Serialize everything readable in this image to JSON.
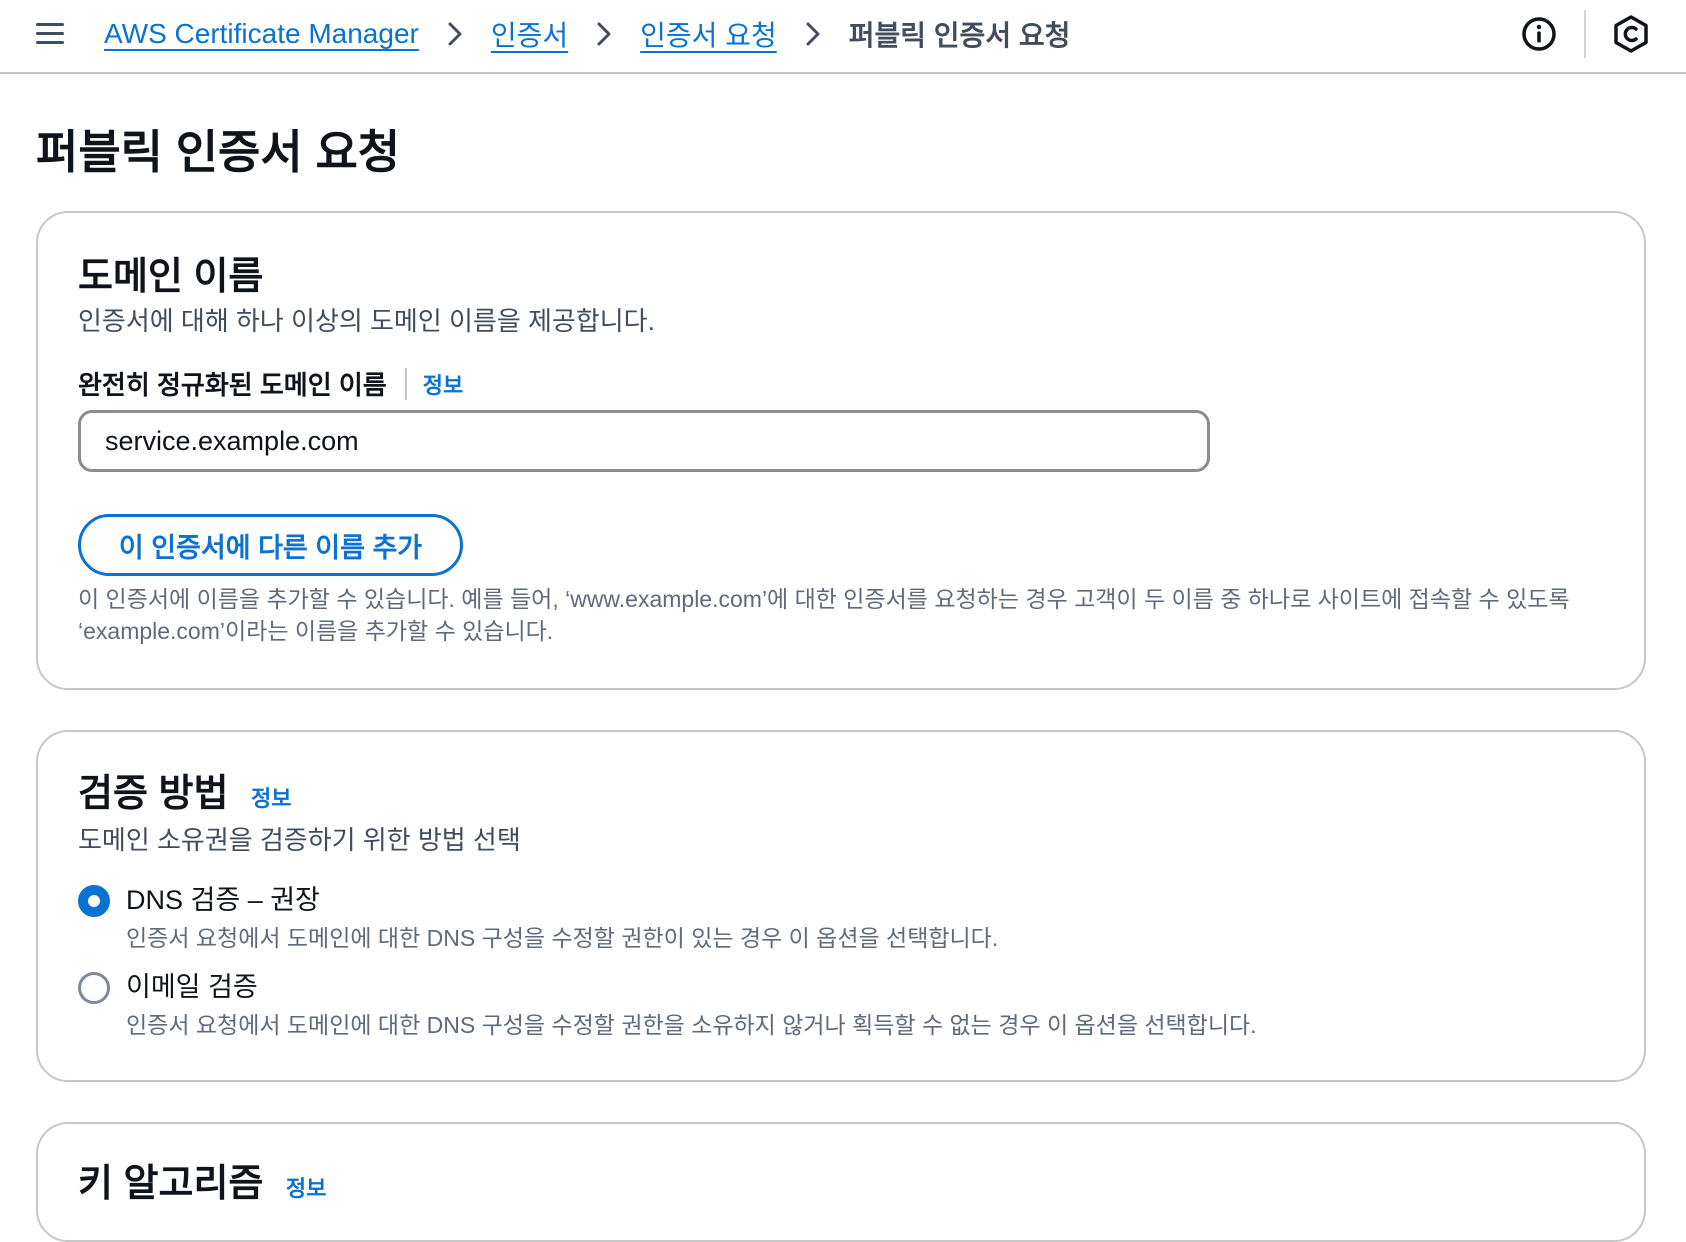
{
  "breadcrumb": {
    "items": [
      "AWS Certificate Manager",
      "인증서",
      "인증서 요청"
    ],
    "current": "퍼블릭 인증서 요청"
  },
  "page": {
    "title": "퍼블릭 인증서 요청"
  },
  "domain_section": {
    "title": "도메인 이름",
    "description": "인증서에 대해 하나 이상의 도메인 이름을 제공합니다.",
    "field_label": "완전히 정규화된 도메인 이름",
    "info_label": "정보",
    "field_value": "service.example.com",
    "add_button_label": "이 인증서에 다른 이름 추가",
    "hint": "이 인증서에 이름을 추가할 수 있습니다. 예를 들어, ‘www.example.com’에 대한 인증서를 요청하는 경우 고객이 두 이름 중 하나로 사이트에 접속할 수 있도록 ‘example.com’이라는 이름을 추가할 수 있습니다."
  },
  "validation_section": {
    "title": "검증 방법",
    "info_label": "정보",
    "description": "도메인 소유권을 검증하기 위한 방법 선택",
    "options": [
      {
        "label": "DNS 검증 – 권장",
        "description": "인증서 요청에서 도메인에 대한 DNS 구성을 수정할 권한이 있는 경우 이 옵션을 선택합니다.",
        "selected": true
      },
      {
        "label": "이메일 검증",
        "description": "인증서 요청에서 도메인에 대한 DNS 구성을 수정할 권한을 소유하지 않거나 획득할 수 없는 경우 이 옵션을 선택합니다.",
        "selected": false
      }
    ]
  },
  "key_section": {
    "title": "키 알고리즘",
    "info_label": "정보"
  },
  "icons": {
    "menu": "hamburger-menu-icon",
    "separator": "chevron-right-icon",
    "info": "info-circle-icon",
    "cloudshell": "hexagon-icon"
  },
  "colors": {
    "link": "#0972d3",
    "border": "#c6c6cd",
    "text": "#0f141a",
    "muted": "#5f6b7a"
  }
}
